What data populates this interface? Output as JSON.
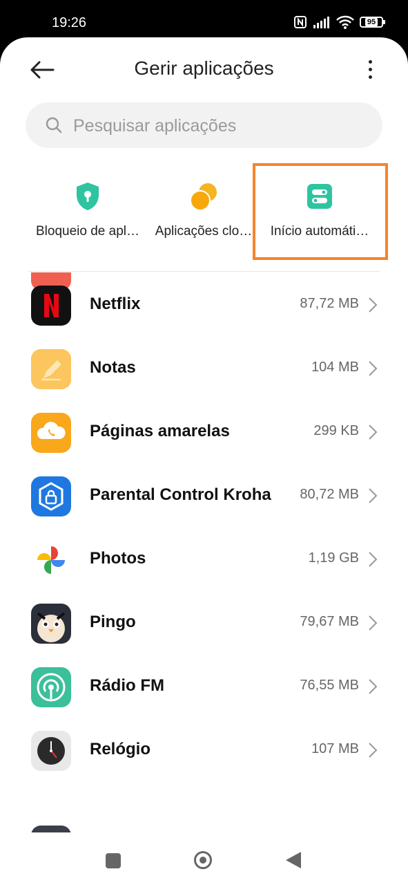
{
  "status_bar": {
    "time": "19:26",
    "battery": "95"
  },
  "header": {
    "title": "Gerir aplicações"
  },
  "search": {
    "placeholder": "Pesquisar aplicações"
  },
  "shortcuts": [
    {
      "label": "Bloqueio de apl…",
      "icon": "shield-lock-icon",
      "color": "#2ec4a0"
    },
    {
      "label": "Aplicações clo…",
      "icon": "dual-circles-icon",
      "color": "#f5b420"
    },
    {
      "label": "Início automáti…",
      "icon": "toggle-switch-icon",
      "color": "#2ec4a0"
    }
  ],
  "highlight_color": "#f5842a",
  "apps": [
    {
      "name": "Netflix",
      "size": "87,72 MB",
      "icon": "netflix-icon"
    },
    {
      "name": "Notas",
      "size": "104 MB",
      "icon": "notes-icon"
    },
    {
      "name": "Páginas amarelas",
      "size": "299 KB",
      "icon": "yellow-pages-icon"
    },
    {
      "name": "Parental Control Kroha",
      "size": "80,72 MB",
      "icon": "parental-control-icon"
    },
    {
      "name": "Photos",
      "size": "1,19 GB",
      "icon": "photos-pinwheel-icon"
    },
    {
      "name": "Pingo",
      "size": "79,67 MB",
      "icon": "pingo-penguin-icon"
    },
    {
      "name": "Rádio FM",
      "size": "76,55 MB",
      "icon": "radio-fm-icon"
    },
    {
      "name": "Relógio",
      "size": "107 MB",
      "icon": "clock-icon"
    }
  ]
}
